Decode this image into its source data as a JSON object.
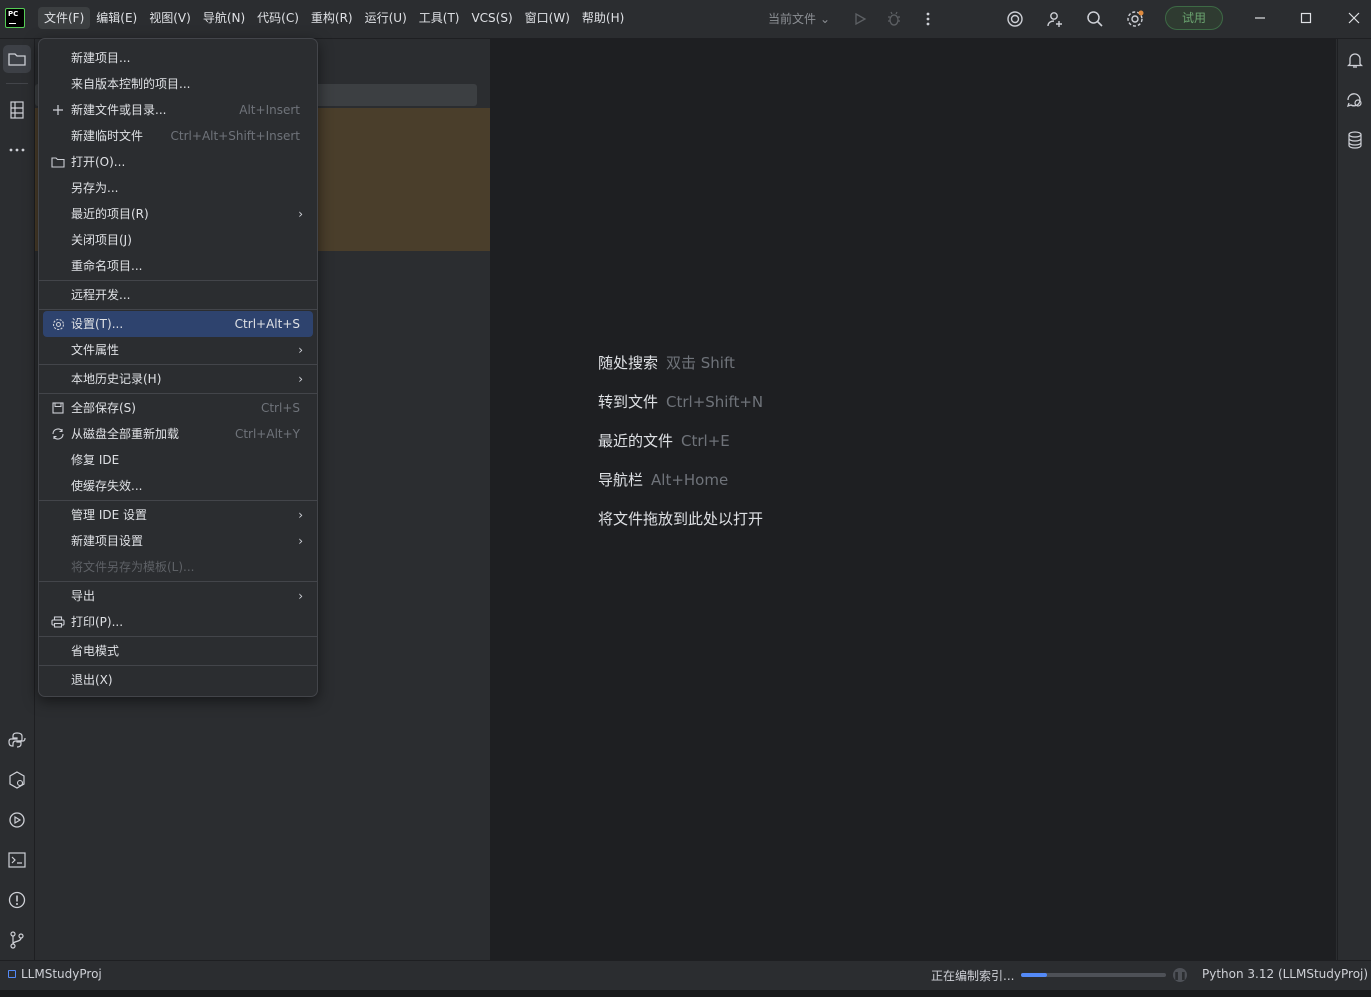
{
  "menubar": {
    "items": [
      {
        "label": "文件(F)"
      },
      {
        "label": "编辑(E)"
      },
      {
        "label": "视图(V)"
      },
      {
        "label": "导航(N)"
      },
      {
        "label": "代码(C)"
      },
      {
        "label": "重构(R)"
      },
      {
        "label": "运行(U)"
      },
      {
        "label": "工具(T)"
      },
      {
        "label": "VCS(S)"
      },
      {
        "label": "窗口(W)"
      },
      {
        "label": "帮助(H)"
      }
    ]
  },
  "toolbar": {
    "run_config": "当前文件",
    "trial_button": "试用"
  },
  "file_menu": {
    "items": [
      {
        "label": "新建项目...",
        "shortcut": "",
        "icon": ""
      },
      {
        "label": "来自版本控制的项目...",
        "shortcut": "",
        "icon": ""
      },
      {
        "label": "新建文件或目录...",
        "shortcut": "Alt+Insert",
        "icon": "plus-icon"
      },
      {
        "label": "新建临时文件",
        "shortcut": "Ctrl+Alt+Shift+Insert",
        "icon": ""
      },
      {
        "label": "打开(O)...",
        "shortcut": "",
        "icon": "folder-icon"
      },
      {
        "label": "另存为...",
        "shortcut": "",
        "icon": ""
      },
      {
        "label": "最近的项目(R)",
        "shortcut": "",
        "icon": "",
        "submenu": true
      },
      {
        "label": "关闭项目(J)",
        "shortcut": "",
        "icon": ""
      },
      {
        "label": "重命名项目...",
        "shortcut": "",
        "icon": ""
      },
      {
        "label": "远程开发...",
        "shortcut": "",
        "icon": ""
      },
      {
        "label": "设置(T)...",
        "shortcut": "Ctrl+Alt+S",
        "icon": "gear-icon",
        "selected": true
      },
      {
        "label": "文件属性",
        "shortcut": "",
        "icon": "",
        "submenu": true
      },
      {
        "label": "本地历史记录(H)",
        "shortcut": "",
        "icon": "",
        "submenu": true
      },
      {
        "label": "全部保存(S)",
        "shortcut": "Ctrl+S",
        "icon": "save-icon"
      },
      {
        "label": "从磁盘全部重新加载",
        "shortcut": "Ctrl+Alt+Y",
        "icon": "reload-icon"
      },
      {
        "label": "修复 IDE",
        "shortcut": "",
        "icon": ""
      },
      {
        "label": "使缓存失效...",
        "shortcut": "",
        "icon": ""
      },
      {
        "label": "管理 IDE 设置",
        "shortcut": "",
        "icon": "",
        "submenu": true
      },
      {
        "label": "新建项目设置",
        "shortcut": "",
        "icon": "",
        "submenu": true
      },
      {
        "label": "将文件另存为模板(L)...",
        "shortcut": "",
        "icon": "",
        "disabled": true
      },
      {
        "label": "导出",
        "shortcut": "",
        "icon": "",
        "submenu": true
      },
      {
        "label": "打印(P)...",
        "shortcut": "",
        "icon": "printer-icon"
      },
      {
        "label": "省电模式",
        "shortcut": "",
        "icon": ""
      },
      {
        "label": "退出(X)",
        "shortcut": "",
        "icon": ""
      }
    ]
  },
  "editor_hints": [
    {
      "label": "随处搜索",
      "key": "双击 Shift"
    },
    {
      "label": "转到文件",
      "key": "Ctrl+Shift+N"
    },
    {
      "label": "最近的文件",
      "key": "Ctrl+E"
    },
    {
      "label": "导航栏",
      "key": "Alt+Home"
    },
    {
      "label": "将文件拖放到此处以打开",
      "key": ""
    }
  ],
  "statusbar": {
    "project": "LLMStudyProj",
    "indexing": "正在编制索引...",
    "progress": 0.18,
    "interpreter": "Python 3.12 (LLMStudyProj)"
  },
  "colors": {
    "accent": "#548af7",
    "selection": "#2e436e",
    "trial": "#6aa36f"
  }
}
